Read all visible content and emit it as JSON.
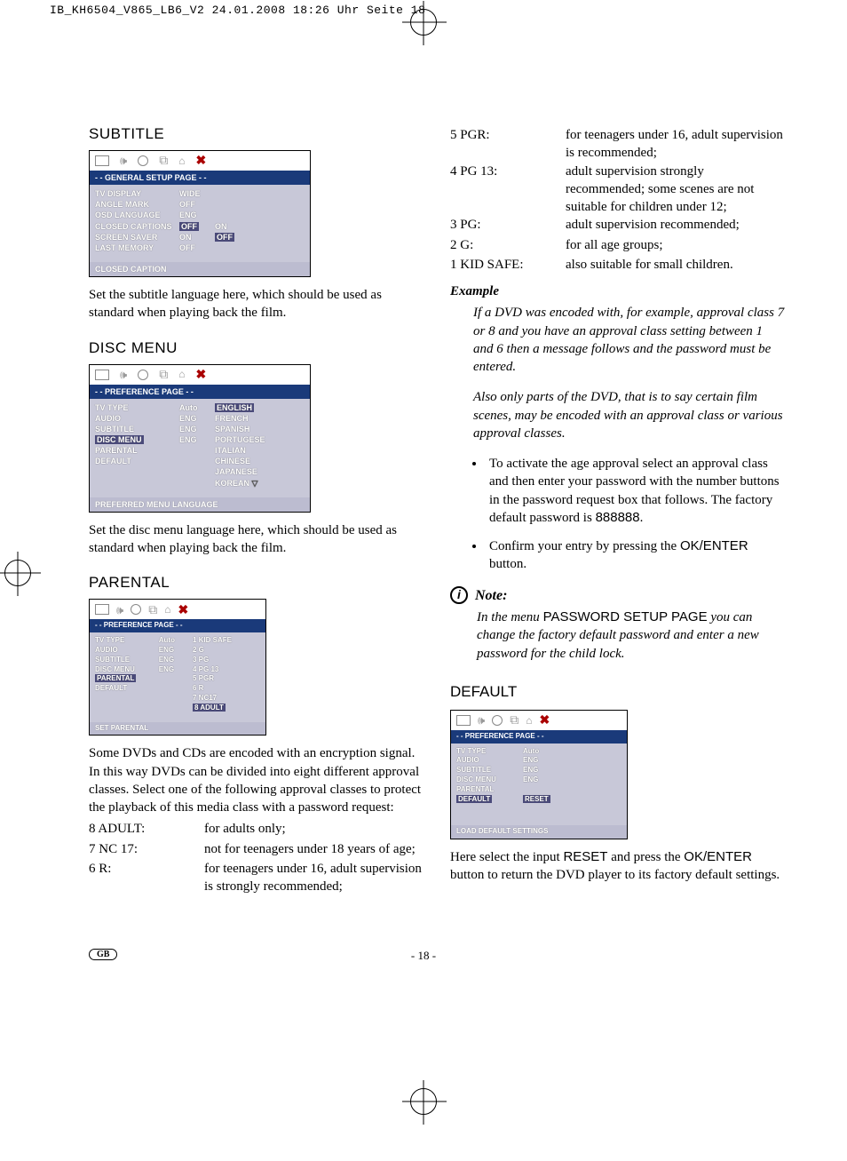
{
  "print_header": "IB_KH6504_V865_LB6_V2  24.01.2008  18:26 Uhr  Seite 18",
  "subtitle": {
    "heading": "SUBTITLE",
    "menu_title": "- - GENERAL SETUP PAGE - -",
    "rows": [
      {
        "label": "TV DISPLAY",
        "val": "WIDE",
        "extra": ""
      },
      {
        "label": "ANGLE MARK",
        "val": "OFF",
        "extra": ""
      },
      {
        "label": "OSD LANGUAGE",
        "val": "ENG",
        "extra": ""
      },
      {
        "label": "CLOSED CAPTIONS",
        "val": "OFF",
        "extra": "ON",
        "hlVal": true
      },
      {
        "label": "SCREEN SAVER",
        "val": "ON",
        "extra": "OFF",
        "hlExtra": true
      },
      {
        "label": "LAST MEMORY",
        "val": "OFF",
        "extra": ""
      }
    ],
    "footer": "CLOSED CAPTION",
    "para": "Set the subtitle language here, which should be used as standard when playing back the film."
  },
  "discmenu": {
    "heading": "DISC MENU",
    "menu_title": "- - PREFERENCE PAGE - -",
    "rows": [
      {
        "label": "TV TYPE",
        "val": "Auto"
      },
      {
        "label": "AUDIO",
        "val": "ENG"
      },
      {
        "label": "SUBTITLE",
        "val": "ENG"
      },
      {
        "label": "DISC MENU",
        "val": "ENG",
        "hlLabel": true
      },
      {
        "label": "PARENTAL",
        "val": ""
      },
      {
        "label": "DEFAULT",
        "val": ""
      }
    ],
    "options": [
      "ENGLISH",
      "FRENCH",
      "SPANISH",
      "PORTUGESE",
      "ITALIAN",
      "CHINESE",
      "JAPANESE",
      "KOREAN"
    ],
    "footer": "PREFERRED MENU LANGUAGE",
    "para": "Set the disc menu language here, which should be used as standard when playing back the film."
  },
  "parental": {
    "heading": "PARENTAL",
    "menu_title": "- - PREFERENCE PAGE - -",
    "rows": [
      {
        "label": "TV TYPE",
        "val": "Auto"
      },
      {
        "label": "AUDIO",
        "val": "ENG"
      },
      {
        "label": "SUBTITLE",
        "val": "ENG"
      },
      {
        "label": "DISC MENU",
        "val": "ENG"
      },
      {
        "label": "PARENTAL",
        "val": "",
        "hlLabel": true
      },
      {
        "label": "DEFAULT",
        "val": ""
      }
    ],
    "options": [
      "1  KID SAFE",
      "2  G",
      "3  PG",
      "4  PG 13",
      "5  PGR",
      "6  R",
      "7  NC17",
      "8  ADULT"
    ],
    "footer": "SET PARENTAL",
    "para": "Some DVDs and CDs are encoded with an encryption signal. In this way DVDs can be divided into eight different approval classes. Select one of the following approval classes to protect the playback of this media class with a password request:",
    "list": [
      {
        "k": "8 ADULT:",
        "v": "for adults only;"
      },
      {
        "k": "7 NC 17:",
        "v": "not for teenagers under 18 years of age;"
      },
      {
        "k": "6 R:",
        "v": "for teenagers under 16, adult supervision is strongly recommended;"
      }
    ]
  },
  "right": {
    "list": [
      {
        "k": "5 PGR:",
        "v": "for teenagers under 16, adult supervision is recommended;"
      },
      {
        "k": "4 PG 13:",
        "v": "adult supervision strongly recommended; some scenes are not suitable for children under 12;"
      },
      {
        "k": "3 PG:",
        "v": "adult supervision recommended;"
      },
      {
        "k": "2 G:",
        "v": "for all age groups;"
      },
      {
        "k": "1 KID SAFE:",
        "v": "also suitable for small children."
      }
    ],
    "example_h": "Example",
    "example_p1": "If a DVD was encoded with, for example, approval class 7 or 8 and you have an approval class setting between 1 and 6 then a message follows and the password must be entered.",
    "example_p2": "Also only parts of the DVD, that is to say certain film scenes, may be encoded with an approval class or various approval classes.",
    "bul1a": "To activate the age approval select an approval class and then enter your password with the number buttons in the password request box that follows. The factory default password is ",
    "bul1b": "888888",
    "bul1c": ".",
    "bul2a": "Confirm your entry by pressing the ",
    "bul2b": "OK/ENTER",
    "bul2c": " button.",
    "note_h": "Note:",
    "note_body_a": "In the menu ",
    "note_body_b": "PASSWORD SETUP PAGE",
    "note_body_c": " you can change the factory default password and enter a new password for the child lock."
  },
  "deft": {
    "heading": "DEFAULT",
    "menu_title": "- - PREFERENCE PAGE - -",
    "rows": [
      {
        "label": "TV TYPE",
        "val": "Auto"
      },
      {
        "label": "AUDIO",
        "val": "ENG"
      },
      {
        "label": "SUBTITLE",
        "val": "ENG"
      },
      {
        "label": "DISC MENU",
        "val": "ENG"
      },
      {
        "label": "PARENTAL",
        "val": ""
      },
      {
        "label": "DEFAULT",
        "val": "RESET",
        "hlLabel": true,
        "hlVal": true
      }
    ],
    "footer": "LOAD DEFAULT SETTINGS",
    "para_a": "Here select the input ",
    "para_b": "RESET",
    "para_c": " and press the ",
    "para_d": "OK/ENTER",
    "para_e": " button to return the DVD player to its factory default settings."
  },
  "pagenum": "- 18 -",
  "gb": "GB"
}
